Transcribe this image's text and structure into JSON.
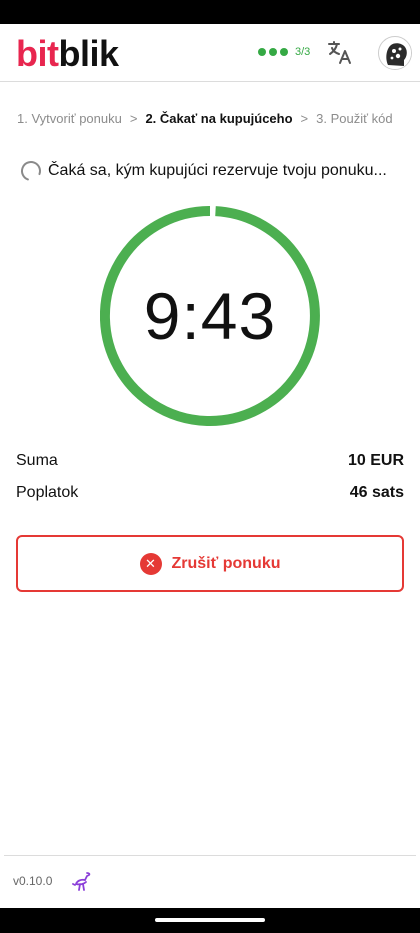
{
  "brand": {
    "part1": "bit",
    "part2": "blik"
  },
  "connection": {
    "count_text": "3/3",
    "color": "#35a944"
  },
  "icons": {
    "translate": "translate-icon",
    "avatar": "avatar-icon",
    "cancel": "close-circle-icon",
    "nostr": "nostr-ostrich-icon"
  },
  "stepper": {
    "step1": "1. Vytvoriť ponuku",
    "sep1": ">",
    "step2": "2. Čakať na kupujúceho",
    "sep2": ">",
    "step3": "3. Použiť kód"
  },
  "status": {
    "waiting_text": "Čaká sa, kým kupujúci rezervuje tvoju ponuku..."
  },
  "timer": {
    "value": "9:43",
    "color": "#4caf50"
  },
  "details": {
    "amount_label": "Suma",
    "amount_value": "10 EUR",
    "fee_label": "Poplatok",
    "fee_value": "46 sats"
  },
  "actions": {
    "cancel_label": "Zrušiť ponuku",
    "cancel_color": "#e53935"
  },
  "footer": {
    "version": "v0.10.0"
  }
}
